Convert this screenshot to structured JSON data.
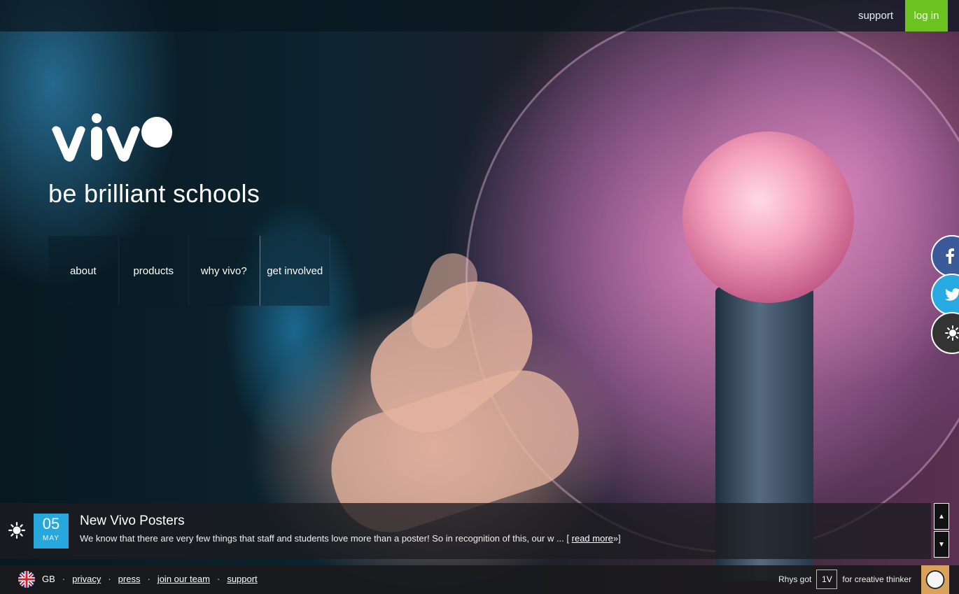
{
  "topbar": {
    "support_label": "support",
    "login_label": "log in",
    "login_color": "#6cc21f"
  },
  "brand": {
    "logo_text": "vivo",
    "tagline": "be brilliant schools"
  },
  "nav": {
    "items": [
      "about",
      "products",
      "why vivo?",
      "get involved"
    ]
  },
  "social": [
    {
      "icon": "facebook-icon",
      "color": "#3b5a9a"
    },
    {
      "icon": "twitter-icon",
      "color": "#29a9e1"
    },
    {
      "icon": "vivo-icon",
      "color": "#333333"
    }
  ],
  "news": {
    "icon": "vivo-icon",
    "day": "05",
    "month": "MAY",
    "title": "New Vivo Posters",
    "excerpt": "We know that there are very few things that staff and students love more than a poster! So in recognition of this, our w ... [",
    "read_more": "read more",
    "suffix": "»]",
    "accent": "#26a8dd"
  },
  "footer": {
    "region": "GB",
    "links": [
      "privacy",
      "press",
      "join our team",
      "support"
    ],
    "reward": {
      "name": "Rhys got",
      "points": "1V",
      "reason": "for creative thinker"
    }
  }
}
